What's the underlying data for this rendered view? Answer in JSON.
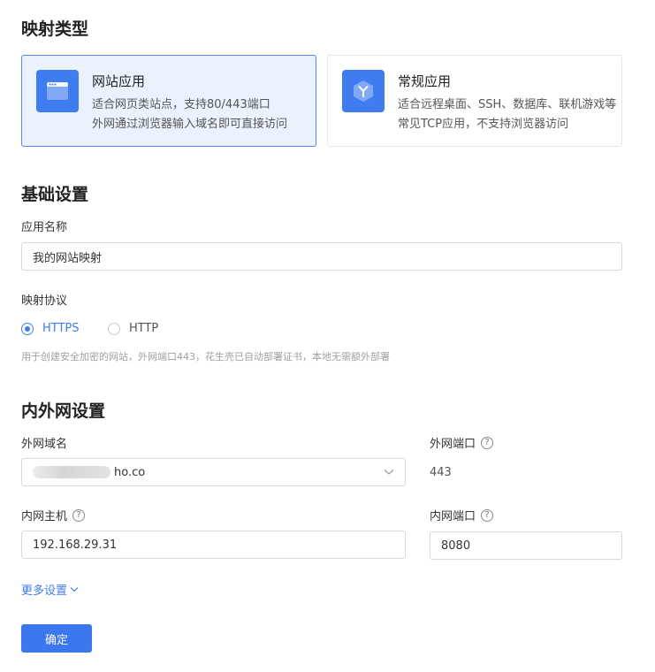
{
  "sections": {
    "mapping_type": "映射类型",
    "basic_settings": "基础设置",
    "network_settings": "内外网设置"
  },
  "cards": [
    {
      "title": "网站应用",
      "desc": "适合网页类站点，支持80/443端口\n外网通过浏览器输入域名即可直接访问",
      "selected": true,
      "icon": "browser-window-icon"
    },
    {
      "title": "常规应用",
      "desc": "适合远程桌面、SSH、数据库、联机游戏等常见TCP应用，不支持浏览器访问",
      "selected": false,
      "icon": "app-hexagon-icon"
    }
  ],
  "app_name": {
    "label": "应用名称",
    "value": "我的网站映射"
  },
  "protocol": {
    "label": "映射协议",
    "options": [
      "HTTPS",
      "HTTP"
    ],
    "selected": "HTTPS",
    "hint": "用于创建安全加密的网站，外网端口443，花生壳已自动部署证书，本地无需额外部署"
  },
  "external_domain": {
    "label": "外网域名",
    "value_suffix": "ho.co"
  },
  "external_port": {
    "label": "外网端口",
    "value": "443",
    "help_icon": "question-circle-icon"
  },
  "internal_host": {
    "label": "内网主机",
    "value": "192.168.29.31",
    "help_icon": "question-circle-icon"
  },
  "internal_port": {
    "label": "内网端口",
    "value": "8080",
    "help_icon": "question-circle-icon"
  },
  "more_settings": {
    "label": "更多设置",
    "icon": "chevron-down-icon"
  },
  "confirm_button": {
    "label": "确定"
  },
  "colors": {
    "accent": "#3f7cf0",
    "card_selected_bg": "#eaf2ff",
    "card_selected_border": "#5b86e5"
  }
}
